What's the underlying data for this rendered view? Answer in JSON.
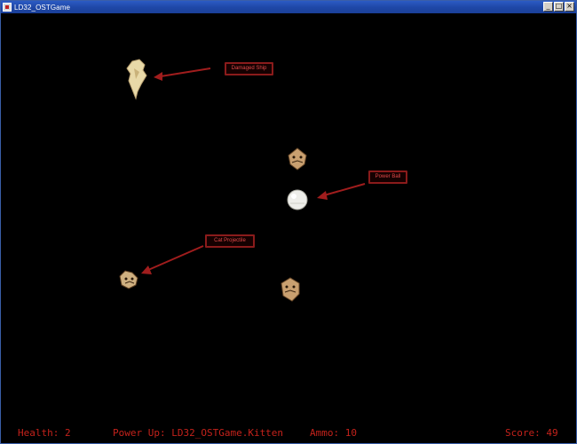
{
  "window": {
    "title": "LD32_OSTGame",
    "controls": {
      "minimize": "_",
      "maximize": "□",
      "close": "×"
    }
  },
  "sprites": {
    "damaged_ship": {
      "label": "Damaged Ship",
      "icon": "damaged-ship-sprite"
    },
    "enemy_top": {
      "icon": "kitten-enemy-sprite"
    },
    "power_up": {
      "label": "Power Ball",
      "icon": "power-ball-sprite"
    },
    "cat_projectile": {
      "label": "Cat Projectile",
      "icon": "cat-projectile-sprite"
    },
    "enemy_bottom": {
      "icon": "kitten-enemy-sprite"
    }
  },
  "hud": {
    "health": "Health: 2",
    "power_up": "Power Up: LD32_OSTGame.Kitten",
    "ammo": "Ammo: 10",
    "score": "Score: 49"
  },
  "colors": {
    "background": "#000000",
    "hud_text": "#c4221b",
    "annotation_border": "#8a1b1b",
    "annotation_arrow": "#a01d1d",
    "titlebar": "#1f48a8"
  }
}
